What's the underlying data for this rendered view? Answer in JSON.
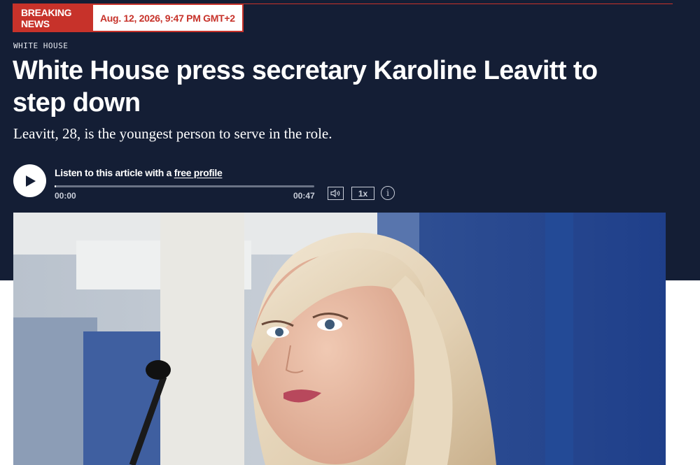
{
  "breaking": {
    "label": "BREAKING NEWS",
    "timestamp": "Aug. 12, 2026, 9:47 PM GMT+2"
  },
  "article": {
    "kicker": "WHITE HOUSE",
    "headline": "White House press secretary Karoline Leavitt to step down",
    "dek": "Leavitt, 28, is the youngest person to serve in the role."
  },
  "audio": {
    "listen_prefix": "Listen to this article with a ",
    "listen_link": "free profile",
    "time_current": "00:00",
    "time_total": "00:47",
    "speed": "1x",
    "info": "i",
    "progress": 0.0,
    "icons": {
      "play": "play-icon",
      "volume": "volume-icon",
      "info": "info-icon"
    }
  },
  "colors": {
    "hero_bg": "#141e35",
    "accent_red": "#c7322a",
    "text_white": "#ffffff",
    "muted": "#c9ced9"
  }
}
